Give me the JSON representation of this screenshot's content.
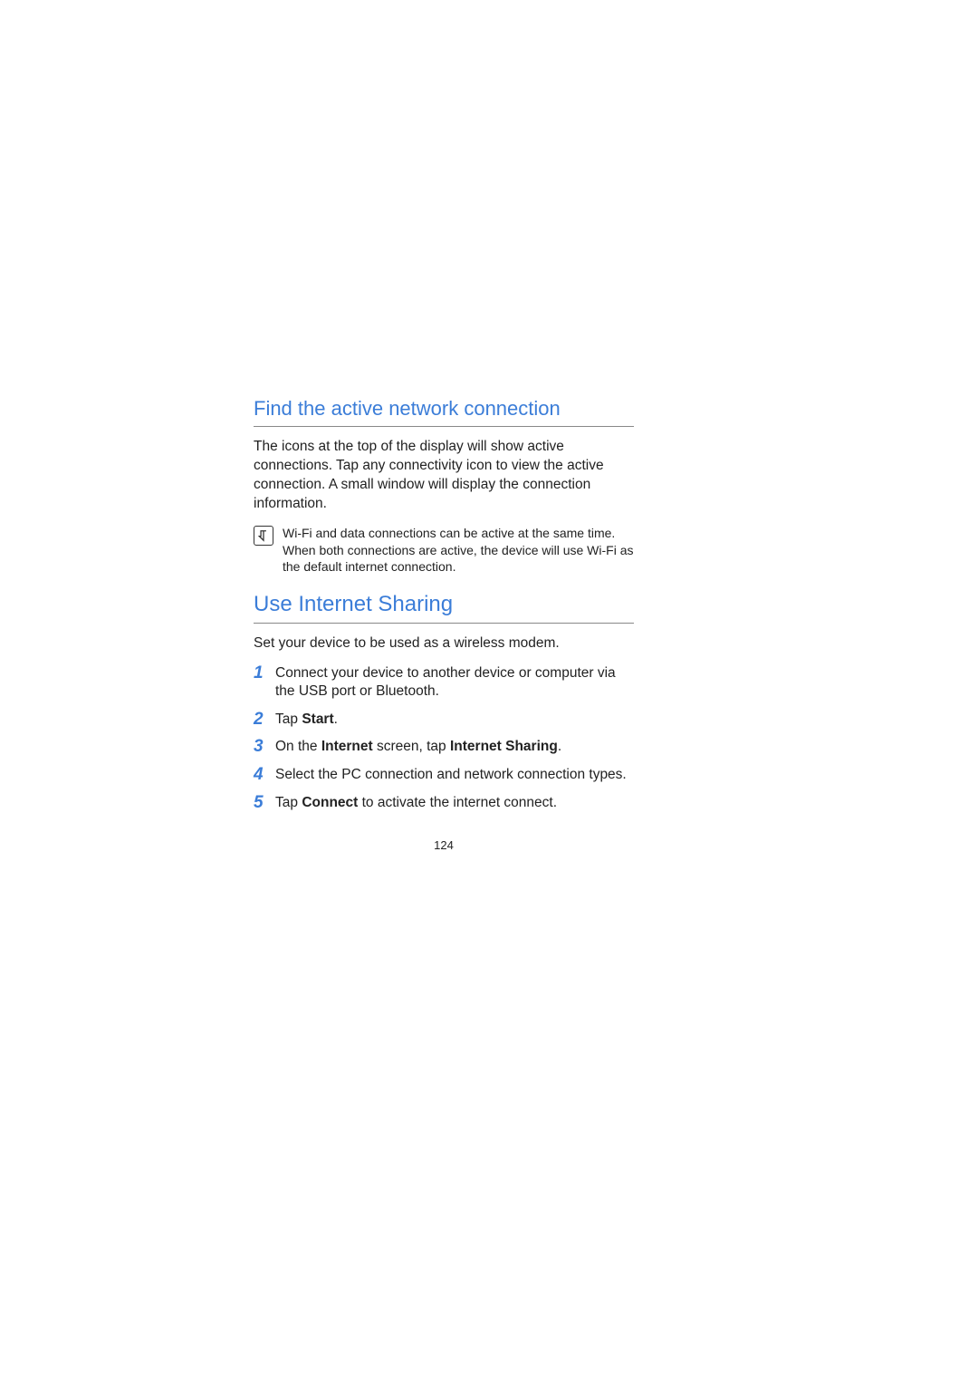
{
  "sections": {
    "section1": {
      "heading": "Find the active network connection",
      "body": "The icons at the top of the display will show active connections. Tap any connectivity icon to view the active connection. A small window will display the connection information."
    },
    "note": {
      "text": "Wi-Fi and data connections can be active at the same time. When both connections are active, the device will use Wi-Fi as the default internet connection."
    },
    "section2": {
      "heading": "Use Internet Sharing",
      "body": "Set your device to be used as a wireless modem."
    },
    "steps": [
      {
        "number": "1",
        "prefix": "Connect your device to another device or computer via the USB port or Bluetooth.",
        "bold1": "",
        "mid": "",
        "bold2": "",
        "suffix": ""
      },
      {
        "number": "2",
        "prefix": "Tap ",
        "bold1": "Start",
        "mid": ".",
        "bold2": "",
        "suffix": ""
      },
      {
        "number": "3",
        "prefix": "On the ",
        "bold1": "Internet",
        "mid": " screen, tap ",
        "bold2": "Internet Sharing",
        "suffix": "."
      },
      {
        "number": "4",
        "prefix": "Select the PC connection and network connection types.",
        "bold1": "",
        "mid": "",
        "bold2": "",
        "suffix": ""
      },
      {
        "number": "5",
        "prefix": "Tap ",
        "bold1": "Connect",
        "mid": " to activate the internet connect.",
        "bold2": "",
        "suffix": ""
      }
    ]
  },
  "page_number": "124"
}
